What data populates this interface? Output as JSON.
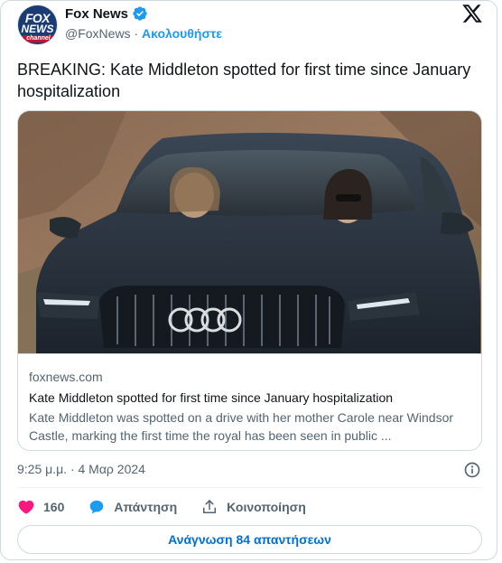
{
  "header": {
    "avatar_logo_top": "FOX",
    "avatar_logo_mid": "NEWS",
    "avatar_logo_bottom": "channel",
    "display_name": "Fox News",
    "handle": "@FoxNews",
    "separator": " · ",
    "follow_label": "Ακολουθήστε"
  },
  "tweet": {
    "text": "BREAKING: Kate Middleton spotted for first time since January hospitalization"
  },
  "link_card": {
    "domain": "foxnews.com",
    "title": "Kate Middleton spotted for first time since January hospitalization",
    "description": "Kate Middleton was spotted on a drive with her mother Carole near Windsor Castle, marking the first time the royal has been seen in public ..."
  },
  "meta": {
    "timestamp": "9:25 μ.μ. · 4 Μαρ 2024"
  },
  "actions": {
    "like_count": "160",
    "reply_label": "Απάντηση",
    "share_label": "Κοινοποίηση"
  },
  "read_replies_label": "Ανάγνωση 84 απαντήσεων",
  "colors": {
    "accent": "#1d9bf0",
    "like": "#f91880",
    "link_button": "#006fd6",
    "muted": "#536471"
  }
}
